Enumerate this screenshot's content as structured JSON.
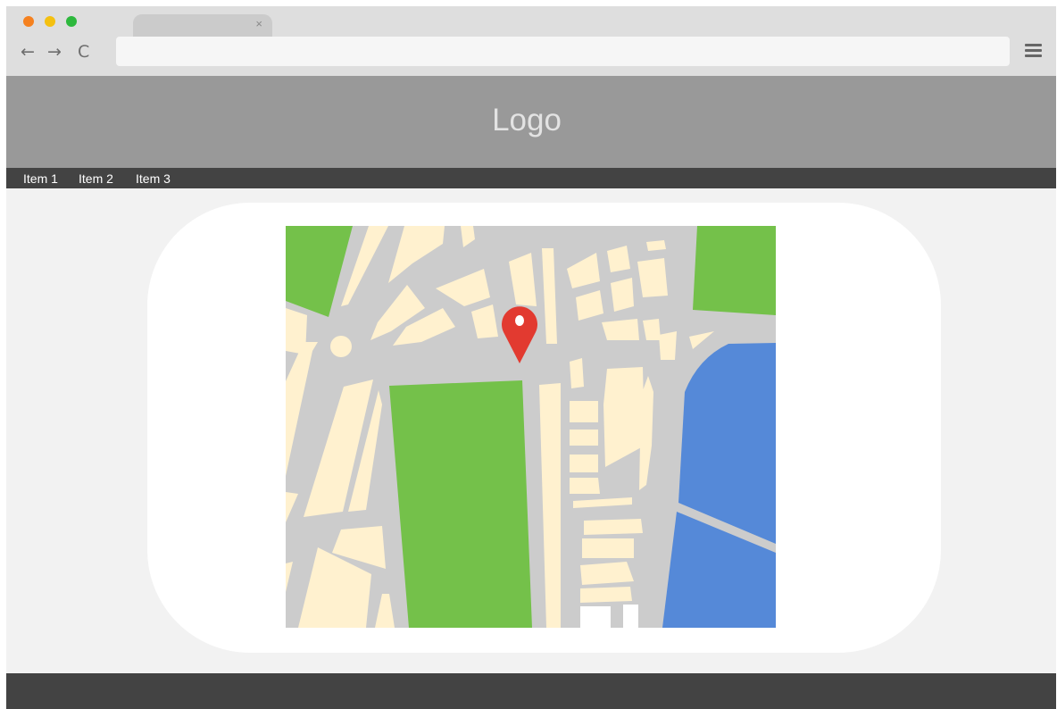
{
  "colors": {
    "close_dot": "#f5811f",
    "minimize_dot": "#f4c010",
    "zoom_dot": "#2db83d",
    "chrome_bg": "#dedede",
    "header_bg": "#999999",
    "nav_bg": "#434343",
    "footer_bg": "#434343",
    "map_park": "#74c14a",
    "map_water": "#5589d8",
    "map_road": "#cccccc",
    "map_block": "#fff1cf",
    "map_pin": "#e23a30"
  },
  "browser": {
    "tab_title": "",
    "tab_close": "×",
    "back_icon": "←",
    "forward_icon": "→",
    "reload_icon": "C",
    "address": ""
  },
  "header": {
    "logo": "Logo"
  },
  "nav": {
    "items": [
      {
        "label": "Item 1"
      },
      {
        "label": "Item 2"
      },
      {
        "label": "Item 3"
      }
    ]
  },
  "main": {
    "map_icon": "map-with-location-pin"
  },
  "icons": [
    "close-dot",
    "minimize-dot",
    "zoom-dot",
    "back-arrow-icon",
    "forward-arrow-icon",
    "reload-icon",
    "hamburger-menu-icon",
    "location-pin-icon"
  ]
}
